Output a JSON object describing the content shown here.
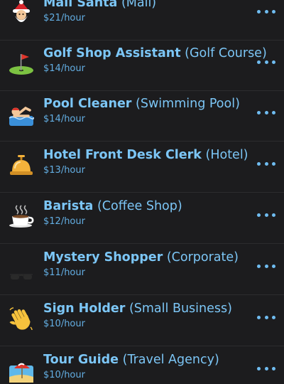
{
  "jobs": [
    {
      "name": "Mall Santa",
      "category": "(Mall)",
      "wage": "$21/hour",
      "icon": "santa-icon"
    },
    {
      "name": "Golf Shop Assistant",
      "category": "(Golf Course)",
      "wage": "$14/hour",
      "icon": "golf-flag-icon"
    },
    {
      "name": "Pool Cleaner",
      "category": "(Swimming Pool)",
      "wage": "$14/hour",
      "icon": "swimmer-icon"
    },
    {
      "name": "Hotel Front Desk Clerk",
      "category": "(Hotel)",
      "wage": "$13/hour",
      "icon": "bellhop-bell-icon"
    },
    {
      "name": "Barista",
      "category": "(Coffee Shop)",
      "wage": "$12/hour",
      "icon": "coffee-cup-icon"
    },
    {
      "name": "Mystery Shopper",
      "category": "(Corporate)",
      "wage": "$11/hour",
      "icon": "sunglasses-icon"
    },
    {
      "name": "Sign Holder",
      "category": "(Small Business)",
      "wage": "$10/hour",
      "icon": "waving-hand-icon"
    },
    {
      "name": "Tour Guide",
      "category": "(Travel Agency)",
      "wage": "$10/hour",
      "icon": "beach-umbrella-icon"
    }
  ],
  "colors": {
    "background": "#1c1c1e",
    "title": "#7cc6f6",
    "wage": "#63aee3",
    "more_dots": "#6fbcf0",
    "divider": "#2c2c2e"
  }
}
